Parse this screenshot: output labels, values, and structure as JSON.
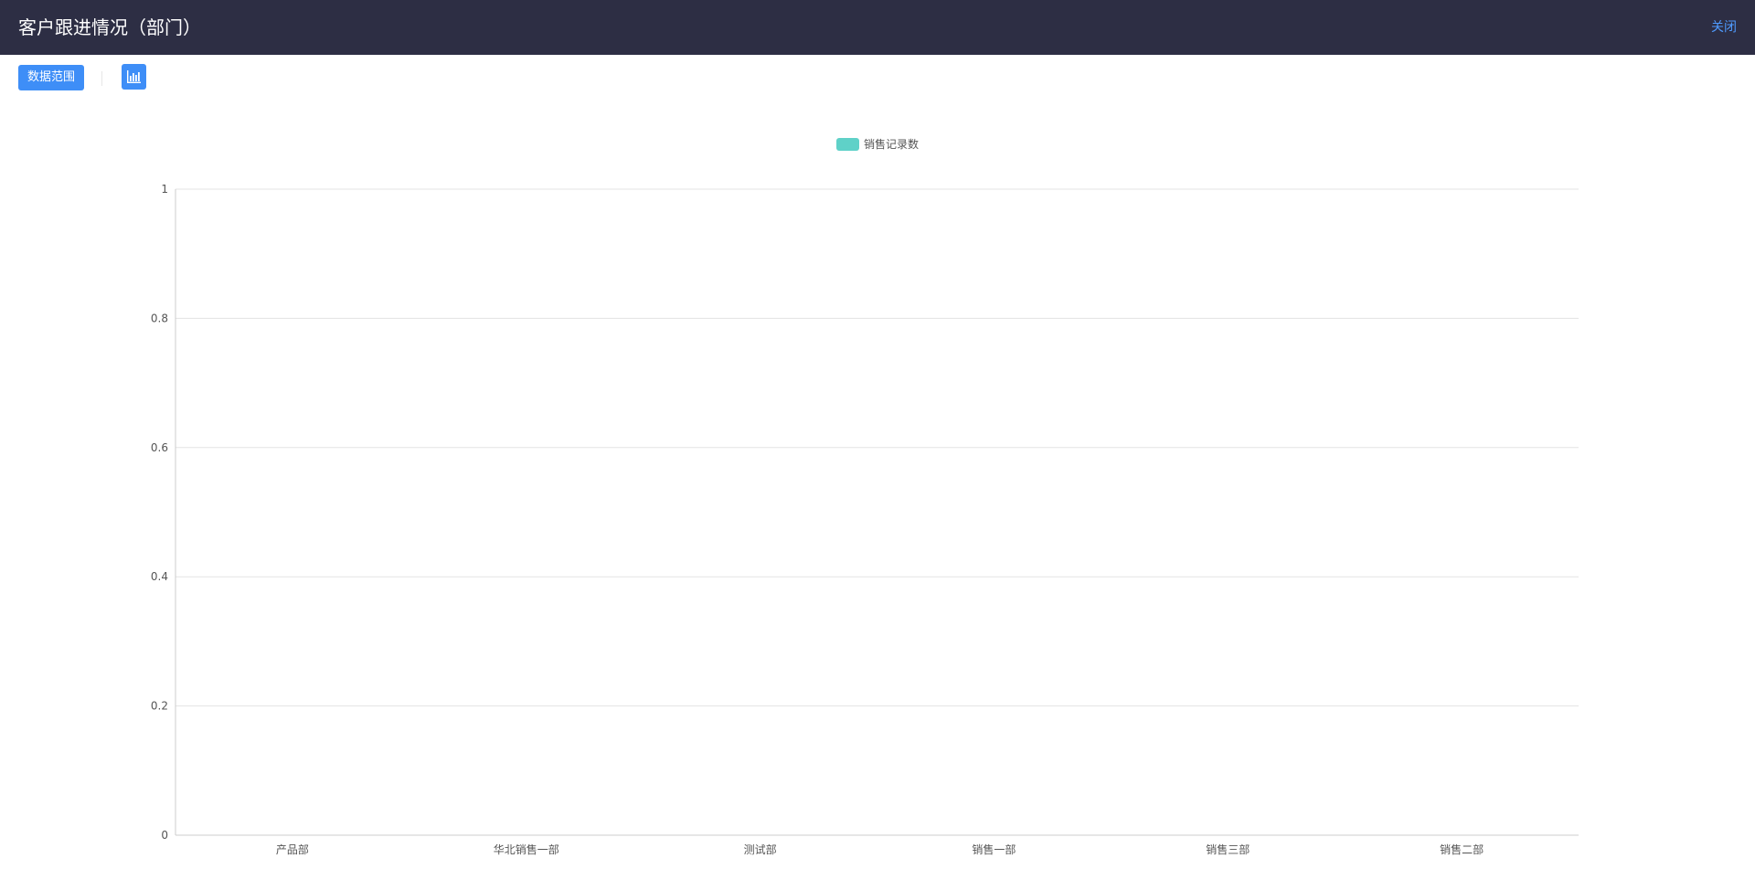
{
  "header": {
    "title": "客户跟进情况（部门）",
    "close_label": "关闭"
  },
  "toolbar": {
    "range_button_label": "数据范围",
    "chart_button_icon": "bar-chart-icon"
  },
  "colors": {
    "header_bg": "#2d2e44",
    "accent": "#3e8ef7",
    "close_link": "#4f9bff",
    "series": "#5fd1c8"
  },
  "chart_data": {
    "type": "bar",
    "categories": [
      "产品部",
      "华北销售一部",
      "测试部",
      "销售一部",
      "销售三部",
      "销售二部"
    ],
    "series": [
      {
        "name": "销售记录数",
        "values": [
          0,
          0,
          0,
          0,
          0,
          0
        ]
      }
    ],
    "ylim": [
      0,
      1
    ],
    "yticks": [
      "0",
      "0.2",
      "0.4",
      "0.6",
      "0.8",
      "1"
    ],
    "grid": true,
    "legend": "top-center"
  }
}
